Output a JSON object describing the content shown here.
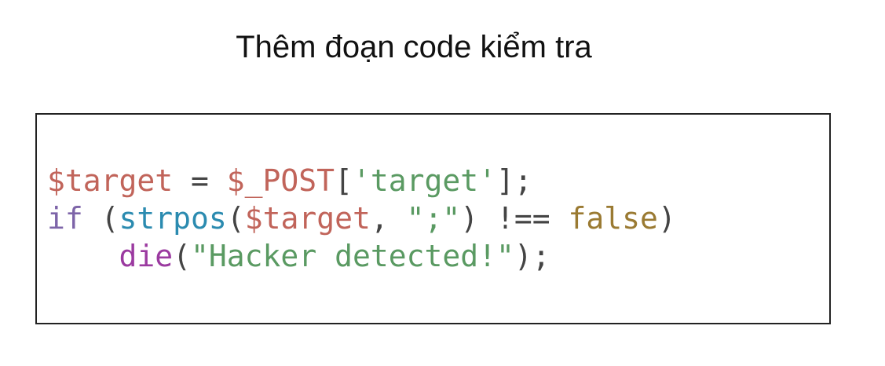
{
  "title": "Thêm đoạn code kiểm tra",
  "colors": {
    "variable": "#c1645a",
    "keyword": "#7d64a8",
    "function": "#2b8bb0",
    "builtin": "#9b3aa0",
    "string": "#5a9a62",
    "literal": "#9a7a32",
    "punctuation": "#444444"
  },
  "code_lines": [
    [
      {
        "text": "$target",
        "kind": "variable"
      },
      {
        "text": " = ",
        "kind": "punctuation"
      },
      {
        "text": "$_POST",
        "kind": "variable"
      },
      {
        "text": "[",
        "kind": "punctuation"
      },
      {
        "text": "'target'",
        "kind": "string"
      },
      {
        "text": "];",
        "kind": "punctuation"
      }
    ],
    [
      {
        "text": "if",
        "kind": "keyword"
      },
      {
        "text": " (",
        "kind": "punctuation"
      },
      {
        "text": "strpos",
        "kind": "function"
      },
      {
        "text": "(",
        "kind": "punctuation"
      },
      {
        "text": "$target",
        "kind": "variable"
      },
      {
        "text": ", ",
        "kind": "punctuation"
      },
      {
        "text": "\";\"",
        "kind": "string"
      },
      {
        "text": ") !== ",
        "kind": "punctuation"
      },
      {
        "text": "false",
        "kind": "literal"
      },
      {
        "text": ")",
        "kind": "punctuation"
      }
    ],
    [
      {
        "text": "    ",
        "kind": "punctuation"
      },
      {
        "text": "die",
        "kind": "builtin"
      },
      {
        "text": "(",
        "kind": "punctuation"
      },
      {
        "text": "\"Hacker detected!\"",
        "kind": "string"
      },
      {
        "text": ");",
        "kind": "punctuation"
      }
    ]
  ]
}
